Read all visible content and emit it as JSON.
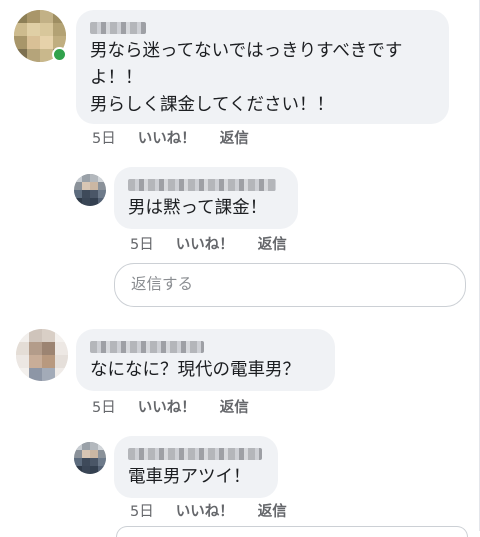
{
  "comments": [
    {
      "message_lines": [
        "男なら迷ってないではっきりすべきです",
        "よ！！",
        "男らしく課金してください！！"
      ],
      "time": "5日",
      "like_label": "いいね！",
      "reply_label": "返信",
      "online": true
    },
    {
      "message_lines": [
        "男は黙って課金！"
      ],
      "time": "5日",
      "like_label": "いいね！",
      "reply_label": "返信"
    },
    {
      "message_lines": [
        "なになに？現代の電車男？"
      ],
      "time": "5日",
      "like_label": "いいね！",
      "reply_label": "返信"
    },
    {
      "message_lines": [
        "電車男アツイ！"
      ],
      "time": "5日",
      "like_label": "いいね！",
      "reply_label": "返信"
    }
  ],
  "reply_input": {
    "placeholder": "返信する"
  },
  "colors": {
    "bubble": "#f0f2f5",
    "meta_text": "#65676b",
    "online": "#31a24c"
  }
}
